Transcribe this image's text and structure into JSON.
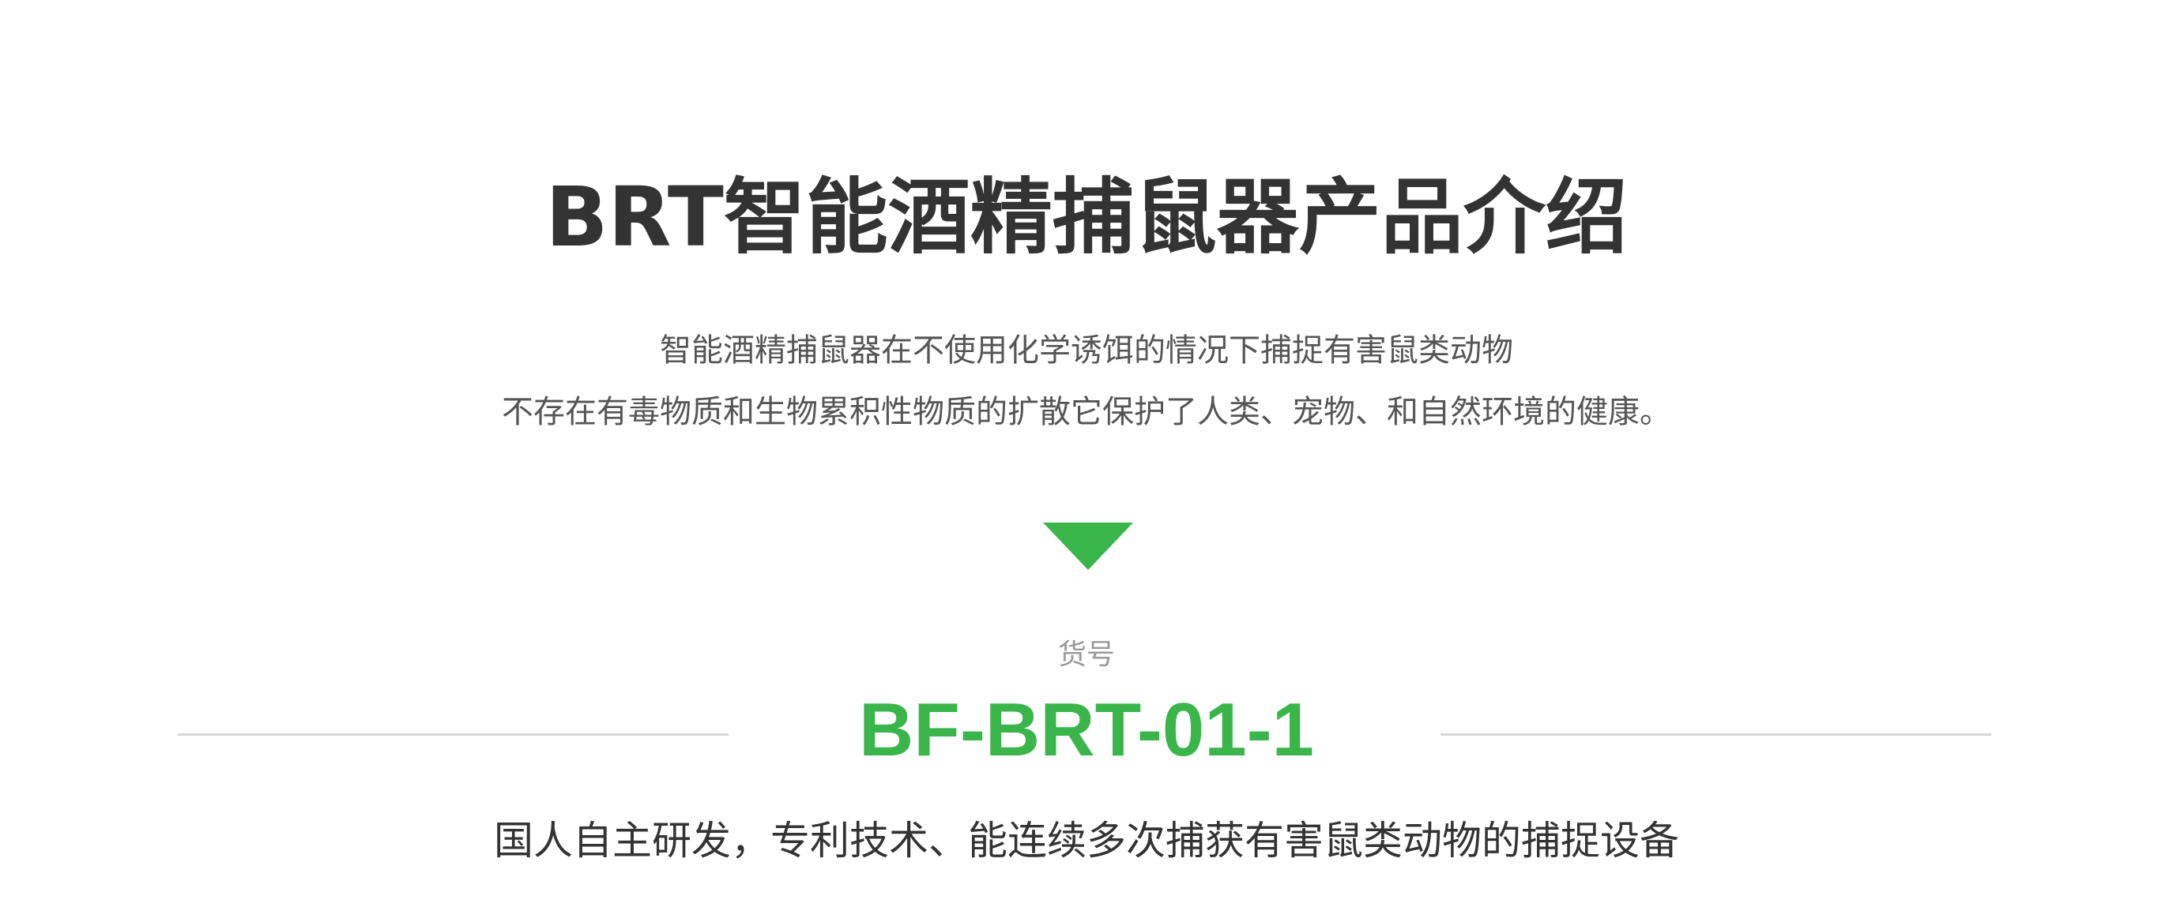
{
  "header": {
    "title": "BRT智能酒精捕鼠器产品介绍"
  },
  "intro": {
    "lines": [
      "智能酒精捕鼠器在不使用化学诱饵的情况下捕捉有害鼠类动物",
      "不存在有毒物质和生物累积性物质的扩散它保护了人类、宠物、和自然环境的健康。"
    ]
  },
  "product": {
    "sku_label": "货号",
    "sku_code": "BF-BRT-01-1",
    "tagline": "国人自主研发，专利技术、能连续多次捕获有害鼠类动物的捕捉设备"
  },
  "colors": {
    "accent": "#39b54a",
    "title": "#333333",
    "body_text": "#555555",
    "muted": "#999999",
    "divider": "#d6d6d6"
  },
  "icons": {
    "arrow": "down-triangle-icon"
  }
}
